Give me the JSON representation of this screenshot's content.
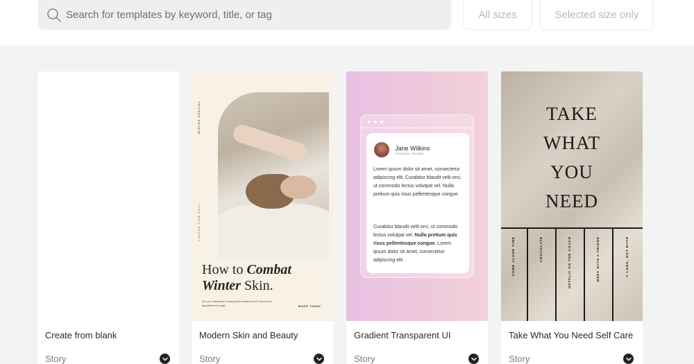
{
  "search": {
    "placeholder": "Search for templates by keyword, title, or tag",
    "value": ""
  },
  "filters": {
    "all_sizes": "All sizes",
    "selected_size_only": "Selected size only"
  },
  "cards": [
    {
      "title": "Create from blank",
      "type": "Story"
    },
    {
      "title": "Modern Skin and Beauty",
      "type": "Story",
      "thumb": {
        "side_text_top": "WINTER SPECIAL",
        "side_text_mid": "LIMITED TIME ONLY",
        "headline_plain": "How to ",
        "headline_bold1": "Combat",
        "headline_bold2": "Winter",
        "headline_plain2": " Skin.",
        "subtext": "Are you interested in trying this treatment out? Book your appointment today!",
        "cta": "BOOK TODAY"
      }
    },
    {
      "title": "Gradient Transparent UI",
      "type": "Story",
      "thumb": {
        "name": "Jane Wilkins",
        "role": "PERSONAL TRAINER",
        "para1": "Lorem ipsum dolor sit amet, consectetur adipiscing elit. Curabitur blandit velit orci, ut commodo lectus volutpat vel. Nulla pretium quis risus pellentesque congue.",
        "para2_a": "Curabitur blandit velit orci, ut commodo lectus volutpat vel. ",
        "para2_bold": "Nulla pretium quis risus pellentesque congue.",
        "para2_b": " Lorem ipsum dolor sit amet, consectetur adipiscing elit."
      }
    },
    {
      "title": "Take What You Need Self Care",
      "type": "Story",
      "thumb": {
        "line1": "TAKE",
        "line2": "WHAT",
        "line3": "YOU",
        "line4": "NEED",
        "tags": [
          "SOME ALONE TIME",
          "CHOCOLATE",
          "NETFLIX ON THE COUCH",
          "MEET WITH A FRIEND",
          "A LONG, HOT BATH"
        ]
      }
    }
  ]
}
